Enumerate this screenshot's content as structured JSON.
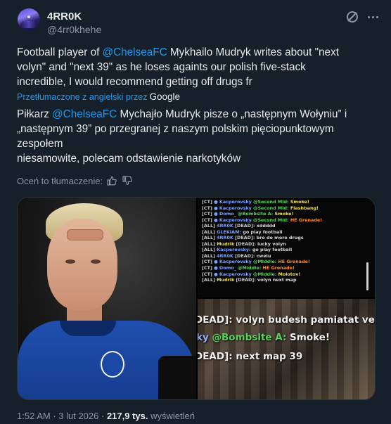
{
  "author": {
    "name": "4RR0K",
    "handle": "@4rr0khehe"
  },
  "tweet": {
    "en_pre": "Football player of ",
    "en_mention": "@ChelseaFC",
    "en_post": " Mykhailo Mudryk writes about \"next\nvolyn\" and \"next 39\" as he loses againts our polish five-stack\nincredible, I would recommend getting off drugs fr",
    "translated_label": "Przetłumaczone z angielski przez",
    "translated_provider": "Google",
    "pl_pre": "Piłkarz ",
    "pl_mention": "@ChelseaFC",
    "pl_post": " Mychajło Mudryk pisze o „następnym Wołyniu” i\n„następnym 39” po przegranej z naszym polskim pięciopunktowym\nzespołem\nniesamowite, polecam odstawienie narkotyków",
    "rate_label": "Oceń to tłumaczenie:"
  },
  "media": {
    "chat": [
      {
        "tag": "[CT]",
        "name": "Kacperovsky",
        "loc": "@Second Mid:",
        "msg": "Smoke!",
        "msg_style": "mud"
      },
      {
        "tag": "[CT]",
        "name": "Kacperovsky",
        "loc": "@Second Mid:",
        "msg": "Flashbang!",
        "msg_style": "mud"
      },
      {
        "tag": "[CT]",
        "name": "Domo_",
        "loc": "@Bombsite A:",
        "msg": "Smoke!",
        "msg_style": "mud"
      },
      {
        "tag": "[CT]",
        "name": "Kacperovsky",
        "loc": "@Second Mid:",
        "msg": "HE Grenade!",
        "msg_style": "warn"
      },
      {
        "tag": "[ALL]",
        "name": "4RR0K",
        "loc": "[DEAD]:",
        "msg": "xddddd",
        "msg_style": "plain"
      },
      {
        "tag": "[ALL]",
        "name": "GLEKIAM:",
        "loc": "",
        "msg": "go play football",
        "msg_style": "plain"
      },
      {
        "tag": "[ALL]",
        "name": "4RR0K",
        "loc": "[DEAD]:",
        "msg": "bro do more drugs",
        "msg_style": "plain"
      },
      {
        "tag": "[ALL]",
        "name": "Mudrik",
        "loc": "[DEAD]:",
        "msg": "lucky volyn",
        "msg_style": "plain"
      },
      {
        "tag": "[ALL]",
        "name": "Kacperovsky:",
        "loc": "",
        "msg": "go play football",
        "msg_style": "plain"
      },
      {
        "tag": "[ALL]",
        "name": "4RR0K",
        "loc": "[DEAD]:",
        "msg": "cwelu",
        "msg_style": "plain"
      },
      {
        "tag": "[CT]",
        "name": "Kacperovsky",
        "loc": "@Middle:",
        "msg": "HE Grenade!",
        "msg_style": "warn"
      },
      {
        "tag": "[CT]",
        "name": "Domo_",
        "loc": "@Middle:",
        "msg": "HE Grenade!",
        "msg_style": "warn"
      },
      {
        "tag": "[CT]",
        "name": "Kacperovsky",
        "loc": "@Middle:",
        "msg": "Molotov!",
        "msg_style": "mud"
      },
      {
        "tag": "[ALL]",
        "name": "Mudrik",
        "loc": "[DEAD]:",
        "msg": "volyn next map",
        "msg_style": "plain"
      }
    ],
    "game_line1": "DEAD]: volyn budesh pamiatat vechn",
    "game_line2_user": "ky ",
    "game_line2_loc": "@Bombsite A:",
    "game_line2_msg": " Smoke!",
    "game_line3": "DEAD]: next map 39"
  },
  "footer": {
    "time": "1:52 AM",
    "sep1": " · ",
    "date": "3 lut 2026",
    "sep2": " · ",
    "views": "217,9 tys.",
    "views_label": " wyświetleń"
  },
  "colors": {
    "background": "#15202b",
    "text": "#e7e9ea",
    "muted": "#8b98a5",
    "link": "#1d9bf0"
  },
  "icons": [
    "grok-icon",
    "more-options-icon",
    "thumbs-up-icon",
    "thumbs-down-icon"
  ]
}
